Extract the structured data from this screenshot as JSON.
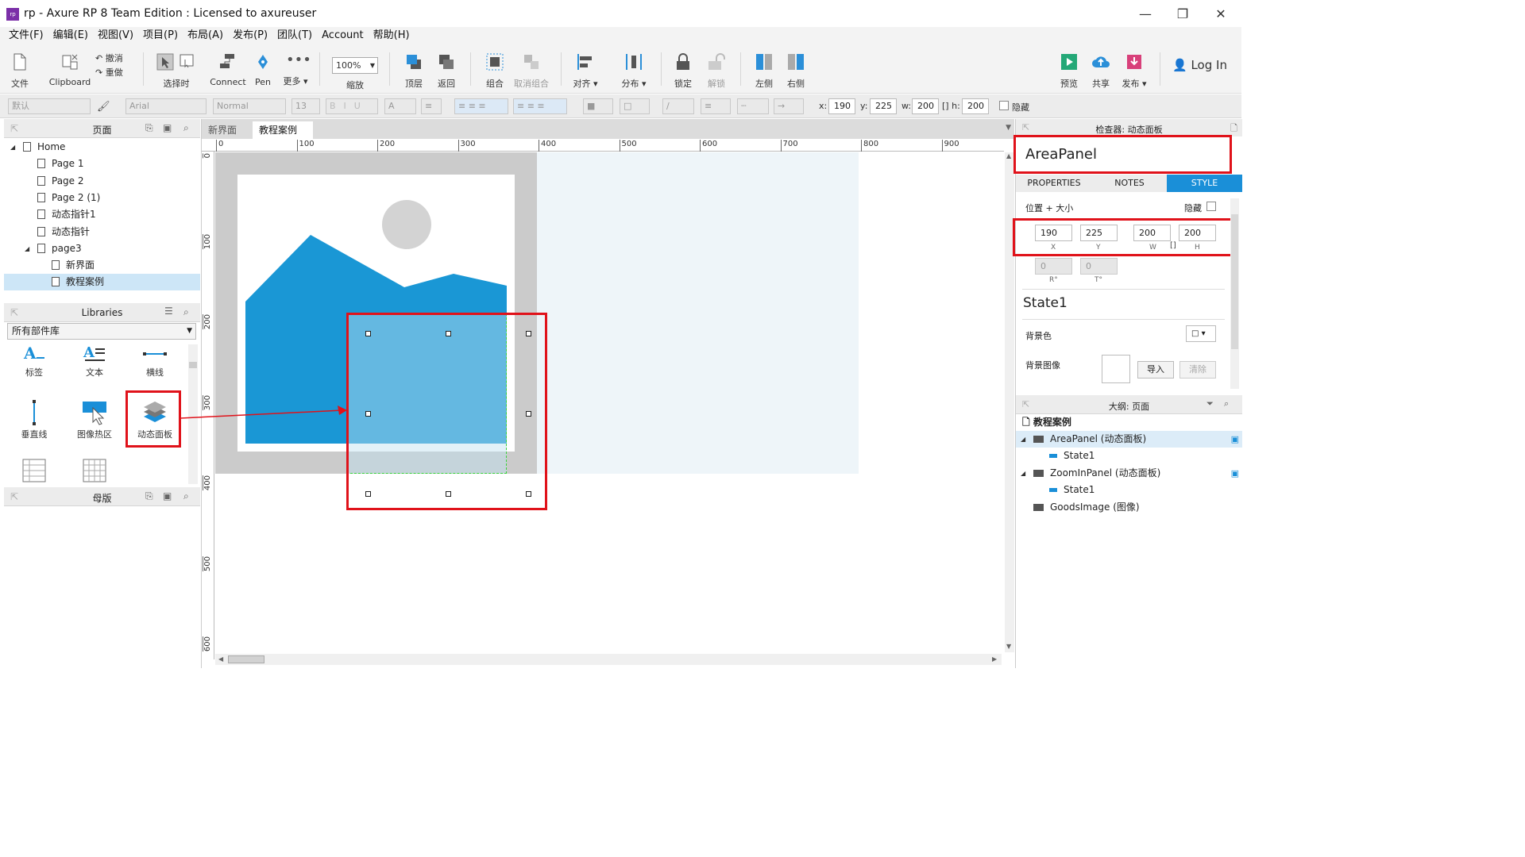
{
  "window": {
    "title": "rp - Axure RP 8 Team Edition : Licensed to axureuser",
    "minimize": "—",
    "restore": "❐",
    "close": "✕"
  },
  "menu": [
    "文件(F)",
    "编辑(E)",
    "视图(V)",
    "项目(P)",
    "布局(A)",
    "发布(P)",
    "团队(T)",
    "Account",
    "帮助(H)"
  ],
  "toolbar": {
    "file": "文件",
    "clipboard": "Clipboard",
    "undo": "撤消",
    "redo": "重做",
    "select_mode": "选择时",
    "connect": "Connect",
    "pen": "Pen",
    "more": "更多 ▾",
    "zoom_value": "100%",
    "zoom": "缩放",
    "top": "顶层",
    "back": "返回",
    "group": "组合",
    "ungroup": "取消组合",
    "align": "对齐 ▾",
    "distribute": "分布 ▾",
    "lock": "锁定",
    "unlock": "解锁",
    "left": "左侧",
    "right": "右侧",
    "preview": "预览",
    "share": "共享",
    "publish": "发布 ▾",
    "login": "Log In"
  },
  "format_bar": {
    "style": "默认",
    "font": "Arial",
    "weight": "Normal",
    "size": "13",
    "x_label": "x:",
    "x": "190",
    "y_label": "y:",
    "y": "225",
    "w_label": "w:",
    "w": "200",
    "h_label": "h:",
    "h": "200",
    "hidden": "隐藏"
  },
  "pages_panel": {
    "title": "页面",
    "items": [
      {
        "label": "Home",
        "level": 0,
        "expanded": true
      },
      {
        "label": "Page 1",
        "level": 1
      },
      {
        "label": "Page 2",
        "level": 1
      },
      {
        "label": "Page 2 (1)",
        "level": 1
      },
      {
        "label": "动态指针1",
        "level": 1
      },
      {
        "label": "动态指针",
        "level": 1
      },
      {
        "label": "page3",
        "level": 1,
        "expanded": true
      },
      {
        "label": "新界面",
        "level": 2
      },
      {
        "label": "教程案例",
        "level": 2,
        "selected": true
      }
    ]
  },
  "libraries_panel": {
    "title": "Libraries",
    "dropdown": "所有部件库",
    "items": [
      "标签",
      "文本",
      "横线",
      "垂直线",
      "图像热区",
      "动态面板"
    ]
  },
  "masters_panel": {
    "title": "母版"
  },
  "canvas": {
    "tabs": [
      {
        "label": "新界面",
        "close": "×"
      },
      {
        "label": "教程案例",
        "close": "×",
        "active": true
      }
    ],
    "ruler_h": [
      "0",
      "100",
      "200",
      "300",
      "400",
      "500",
      "600",
      "700",
      "800",
      "900"
    ],
    "ruler_v": [
      "0",
      "100",
      "200",
      "300",
      "400",
      "500",
      "600"
    ]
  },
  "inspector": {
    "header": "检查器: 动态面板",
    "widget_name": "AreaPanel",
    "tabs": [
      "PROPERTIES",
      "NOTES",
      "STYLE"
    ],
    "active_tab": "STYLE",
    "position_size_label": "位置 + 大小",
    "hidden_label": "隐藏",
    "x": "190",
    "y": "225",
    "w": "200",
    "h": "200",
    "x_lab": "X",
    "y_lab": "Y",
    "w_lab": "W",
    "h_lab": "H",
    "r": "0",
    "t": "0",
    "r_lab": "R°",
    "t_lab": "T°",
    "state_name": "State1",
    "bg_color_label": "背景色",
    "bg_image_label": "背景图像",
    "import_button": "导入",
    "clear_button": "清除"
  },
  "outline": {
    "header": "大纲: 页面",
    "page": "教程案例",
    "items": [
      {
        "label": "AreaPanel (动态面板)",
        "level": 0,
        "selected": true
      },
      {
        "label": "State1",
        "level": 1
      },
      {
        "label": "ZoomInPanel (动态面板)",
        "level": 0
      },
      {
        "label": "State1",
        "level": 1
      },
      {
        "label": "GoodsImage (图像)",
        "level": 0
      }
    ]
  },
  "colors": {
    "accent": "#1a8fd8",
    "image_blue": "#1a97d5",
    "highlight_red": "#e0121a",
    "selection_green": "#3ad13a"
  }
}
